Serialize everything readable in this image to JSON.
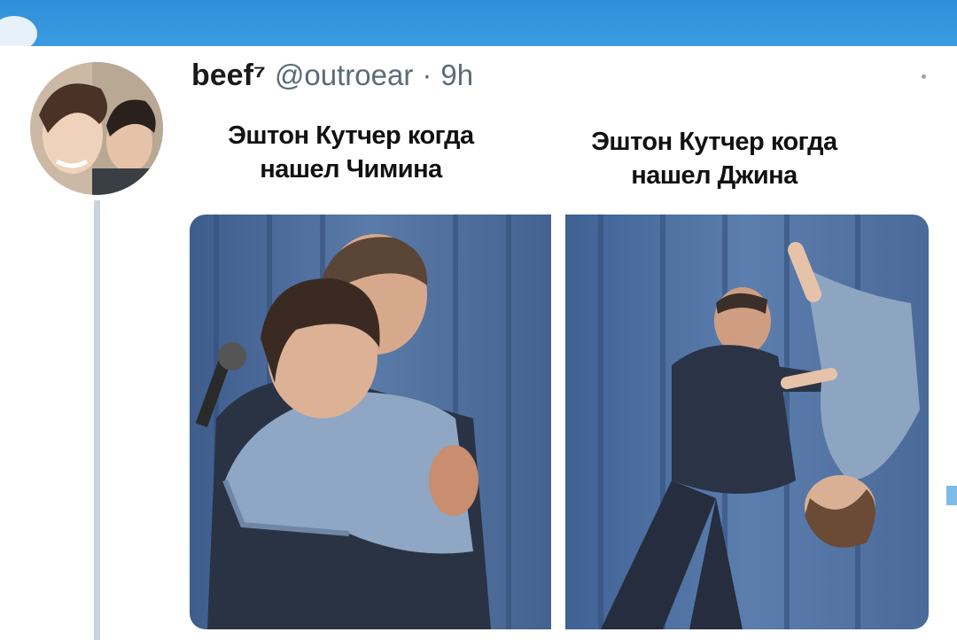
{
  "tweet": {
    "display_name": "beef⁷",
    "handle": "@outroear",
    "separator": "·",
    "time": "9h",
    "captions": [
      {
        "line1": "Эштон Кутчер когда",
        "line2": "нашел Чимина"
      },
      {
        "line1": "Эштон Кутчер когда",
        "line2": "нашел Джина"
      }
    ],
    "more_icon": "more-options-icon"
  },
  "colors": {
    "top_bar": "#3b9be2",
    "thread_line": "#c9d3dc",
    "curtain": "#4a6a99"
  }
}
